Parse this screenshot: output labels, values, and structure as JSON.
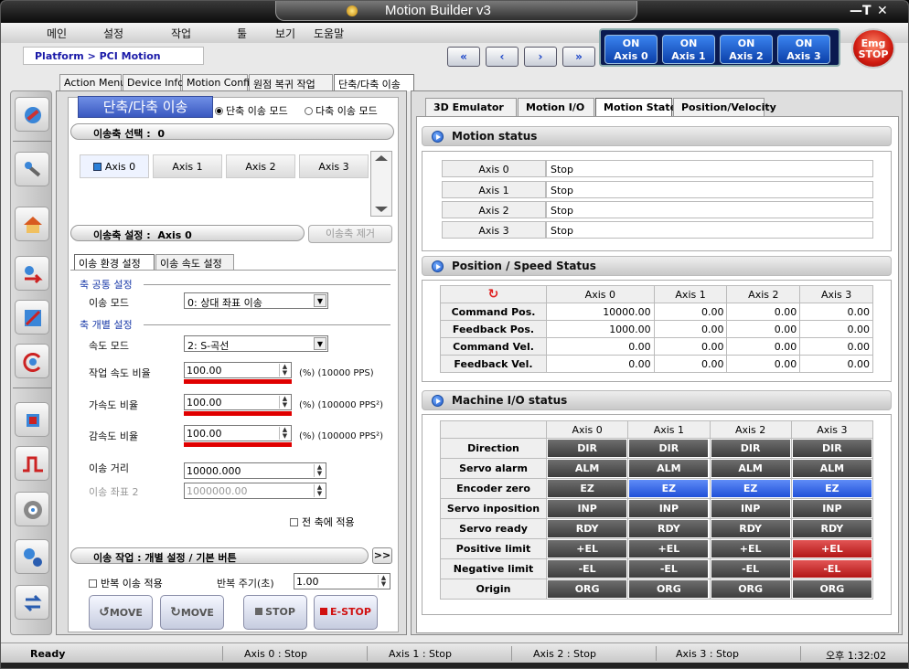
{
  "app": {
    "title": "Motion Builder v3",
    "win_buttons": [
      "—",
      "T",
      "✕"
    ]
  },
  "menu": [
    "메인",
    "설정",
    "작업",
    "툴",
    "보기",
    "도움말"
  ],
  "breadcrumb": "Platform > PCI Motion",
  "nav": [
    "«",
    "‹",
    "›",
    "»"
  ],
  "axis_buttons": [
    {
      "state": "ON",
      "label": "Axis  0"
    },
    {
      "state": "ON",
      "label": "Axis  1"
    },
    {
      "state": "ON",
      "label": "Axis  2"
    },
    {
      "state": "ON",
      "label": "Axis  3"
    }
  ],
  "emg": {
    "line1": "Emg",
    "line2": "STOP"
  },
  "sidebar_icons": [
    "settings-wrench-icon",
    "tools-icon",
    "home-icon",
    "transfer-arrows-icon",
    "pen-draw-icon",
    "circular-arrow-icon",
    "chip-icon",
    "pulse-wave-icon",
    "gear-disk-icon",
    "network-icon",
    "cycle-arrows-icon"
  ],
  "top_tabs": [
    "Action Menu",
    "Device Info",
    "Motion Config",
    "원점 복귀 작업",
    "단축/다축 이송"
  ],
  "left": {
    "title": "단축/다축 이송",
    "mode_single": "단축 이송 모드",
    "mode_multi": "다축 이송 모드",
    "axis_select_label": "이송축 선택 :",
    "axis_select_value": "0",
    "axis_buttons": [
      "Axis 0",
      "Axis 1",
      "Axis 2",
      "Axis 3"
    ],
    "axis_setting_label": "이송축 설정 :",
    "axis_setting_value": "Axis 0",
    "remove_axis": "이송축 제거",
    "sub_tabs": [
      "이송 환경 설정",
      "이송 속도 설정"
    ],
    "common_group": "축 공통 설정",
    "move_mode_label": "이송 모드",
    "move_mode_value": "0: 상대 좌표 이송",
    "individual_group": "축 개별 설정",
    "speed_mode_label": "속도 모드",
    "speed_mode_value": "2: S-곡선",
    "work_speed_label": "작업 속도 비율",
    "work_speed_value": "100.00",
    "work_speed_unit": "(%) (10000 PPS)",
    "accel_label": "가속도 비율",
    "accel_value": "100.00",
    "accel_unit": "(%) (100000 PPS²)",
    "decel_label": "감속도 비율",
    "decel_value": "100.00",
    "decel_unit": "(%) (100000 PPS²)",
    "distance_label": "이송 거리",
    "distance_value": "10000.000",
    "coord2_label": "이송 좌표 2",
    "coord2_value": "1000000.00",
    "apply_all": "전 축에 적용",
    "job_label": "이송 작업 : 개별 설정 / 기본 버튼",
    "expand": ">>",
    "repeat_label": "반복 이송 적용",
    "period_label": "반복 주기(초)",
    "period_value": "1.00",
    "btn_move_ccw": "MOVE",
    "btn_move_cw": "MOVE",
    "btn_stop": "STOP",
    "btn_estop": "E-STOP"
  },
  "right": {
    "tabs": [
      "3D Emulator",
      "Motion I/O",
      "Motion State",
      "Position/Velocity"
    ],
    "motion_status_title": "Motion status",
    "motion_status": [
      {
        "axis": "Axis  0",
        "state": "Stop"
      },
      {
        "axis": "Axis  1",
        "state": "Stop"
      },
      {
        "axis": "Axis  2",
        "state": "Stop"
      },
      {
        "axis": "Axis  3",
        "state": "Stop"
      }
    ],
    "pos_title": "Position / Speed Status",
    "axis_headers": [
      "Axis 0",
      "Axis 1",
      "Axis 2",
      "Axis 3"
    ],
    "pos_rows": [
      {
        "label": "Command Pos.",
        "values": [
          "10000.00",
          "0.00",
          "0.00",
          "0.00"
        ]
      },
      {
        "label": "Feedback Pos.",
        "values": [
          "1000.00",
          "0.00",
          "0.00",
          "0.00"
        ]
      },
      {
        "label": "Command Vel.",
        "values": [
          "0.00",
          "0.00",
          "0.00",
          "0.00"
        ]
      },
      {
        "label": "Feedback Vel.",
        "values": [
          "0.00",
          "0.00",
          "0.00",
          "0.00"
        ]
      }
    ],
    "io_title": "Machine I/O status",
    "io_rows": [
      {
        "label": "Direction",
        "code": "DIR",
        "states": [
          "off",
          "off",
          "off",
          "off"
        ]
      },
      {
        "label": "Servo alarm",
        "code": "ALM",
        "states": [
          "off",
          "off",
          "off",
          "off"
        ]
      },
      {
        "label": "Encoder zero",
        "code": "EZ",
        "states": [
          "off",
          "blue",
          "blue",
          "blue"
        ]
      },
      {
        "label": "Servo inposition",
        "code": "INP",
        "states": [
          "off",
          "off",
          "off",
          "off"
        ]
      },
      {
        "label": "Servo ready",
        "code": "RDY",
        "states": [
          "off",
          "off",
          "off",
          "off"
        ]
      },
      {
        "label": "Positive limit",
        "code": "+EL",
        "states": [
          "off",
          "off",
          "off",
          "red"
        ]
      },
      {
        "label": "Negative  limit",
        "code": "-EL",
        "states": [
          "off",
          "off",
          "off",
          "red"
        ]
      },
      {
        "label": "Origin",
        "code": "ORG",
        "states": [
          "off",
          "off",
          "off",
          "off"
        ]
      }
    ]
  },
  "status": {
    "ready": "Ready",
    "axes": [
      "Axis 0 :  Stop",
      "Axis 1 :  Stop",
      "Axis 2 :  Stop",
      "Axis 3 :  Stop"
    ],
    "time": "오후 1:32:02"
  }
}
